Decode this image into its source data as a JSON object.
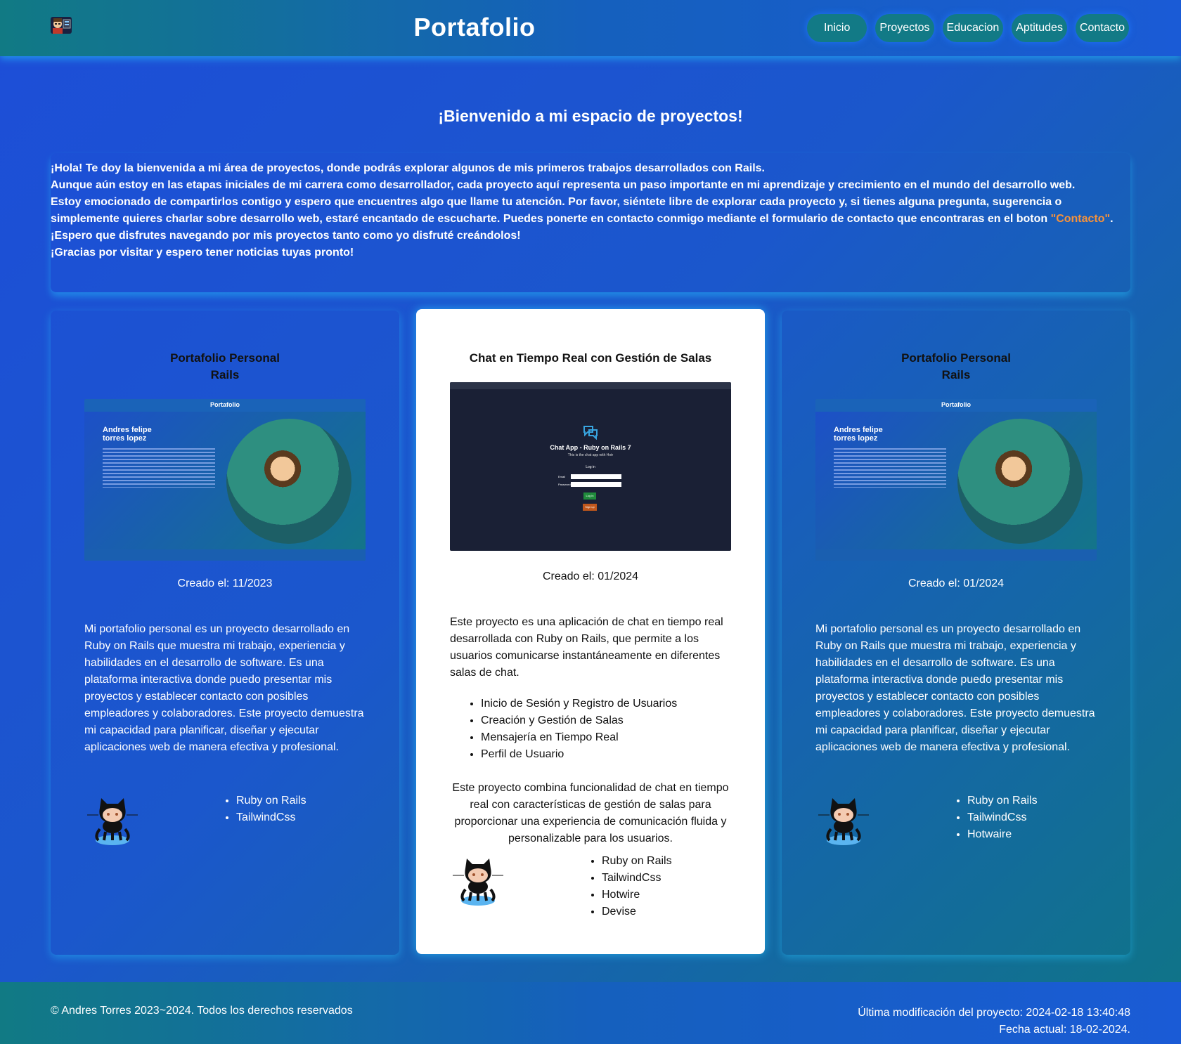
{
  "header": {
    "title": "Portafolio",
    "nav": [
      "Inicio",
      "Proyectos",
      "Educacion",
      "Aptitudes",
      "Contacto"
    ]
  },
  "intro": {
    "heading": "¡Bienvenido a mi espacio de proyectos!",
    "line1": "¡Hola! Te doy la bienvenida a mi área de proyectos, donde podrás explorar algunos de mis primeros trabajos desarrollados con Rails.",
    "line2": "Aunque aún estoy en las etapas iniciales de mi carrera como desarrollador, cada proyecto aquí representa un paso importante en mi aprendizaje y crecimiento en el mundo del desarrollo web.",
    "line3": "Estoy emocionado de compartirlos contigo y espero que encuentres algo que llame tu atención. Por favor, siéntete libre de explorar cada proyecto y, si tienes alguna pregunta, sugerencia o simplemente quieres charlar sobre desarrollo web, estaré encantado de escucharte. Puedes ponerte en contacto conmigo mediante el formulario de contacto que encontraras en el boton ",
    "contact_link": "\"Contacto\"",
    "line3_end": ".",
    "line4": "¡Espero que disfrutes navegando por mis proyectos tanto como yo disfruté creándolos!",
    "line5": "¡Gracias por visitar y espero tener noticias tuyas pronto!"
  },
  "projects": [
    {
      "title_line1": "Portafolio Personal",
      "title_line2": "Rails",
      "created": "Creado el: 11/2023",
      "description": "Mi portafolio personal es un proyecto desarrollado en Ruby on Rails que muestra mi trabajo, experiencia y habilidades en el desarrollo de software. Es una plataforma interactiva donde puedo presentar mis proyectos y establecer contacto con posibles empleadores y colaboradores. Este proyecto demuestra mi capacidad para planificar, diseñar y ejecutar aplicaciones web de manera efectiva y profesional.",
      "tech": [
        "Ruby on Rails",
        "TailwindCss"
      ],
      "screenshot": {
        "site_title": "Portafolio",
        "name_line1": "Andres felipe",
        "name_line2": "torres lopez"
      }
    },
    {
      "title": "Chat en Tiempo Real con Gestión de Salas",
      "created": "Creado el: 01/2024",
      "description": "Este proyecto es una aplicación de chat en tiempo real desarrollada con Ruby on Rails, que permite a los usuarios comunicarse instantáneamente en diferentes salas de chat.",
      "features": [
        "Inicio de Sesión y Registro de Usuarios",
        "Creación y Gestión de Salas",
        "Mensajería en Tiempo Real",
        "Perfil de Usuario"
      ],
      "summary": "Este proyecto combina funcionalidad de chat en tiempo real con características de gestión de salas para proporcionar una experiencia de comunicación fluida y personalizable para los usuarios.",
      "tech": [
        "Ruby on Rails",
        "TailwindCss",
        "Hotwire",
        "Devise"
      ],
      "screenshot": {
        "app_title": "Chat App - Ruby on Rails 7",
        "subtitle": "This is the chat app with Hotr",
        "login_heading": "Log in",
        "email_label": "Email",
        "password_label": "Password",
        "login_button": "Log in",
        "signup_button": "Sign up"
      }
    },
    {
      "title_line1": "Portafolio Personal",
      "title_line2": "Rails",
      "created": "Creado el: 01/2024",
      "description": "Mi portafolio personal es un proyecto desarrollado en Ruby on Rails que muestra mi trabajo, experiencia y habilidades en el desarrollo de software. Es una plataforma interactiva donde puedo presentar mis proyectos y establecer contacto con posibles empleadores y colaboradores. Este proyecto demuestra mi capacidad para planificar, diseñar y ejecutar aplicaciones web de manera efectiva y profesional.",
      "tech": [
        "Ruby on Rails",
        "TailwindCss",
        "Hotwaire"
      ],
      "screenshot": {
        "site_title": "Portafolio",
        "name_line1": "Andres felipe",
        "name_line2": "torres lopez"
      }
    }
  ],
  "footer": {
    "copyright": "© Andres Torres 2023~2024. Todos los derechos reservados",
    "last_modified": "Última modificación del proyecto: 2024-02-18 13:40:48",
    "current_date": "Fecha actual: 18-02-2024."
  },
  "colors": {
    "highlight": "#f7923a",
    "nav_pill": "#127a86",
    "glow": "#28c8ff"
  }
}
